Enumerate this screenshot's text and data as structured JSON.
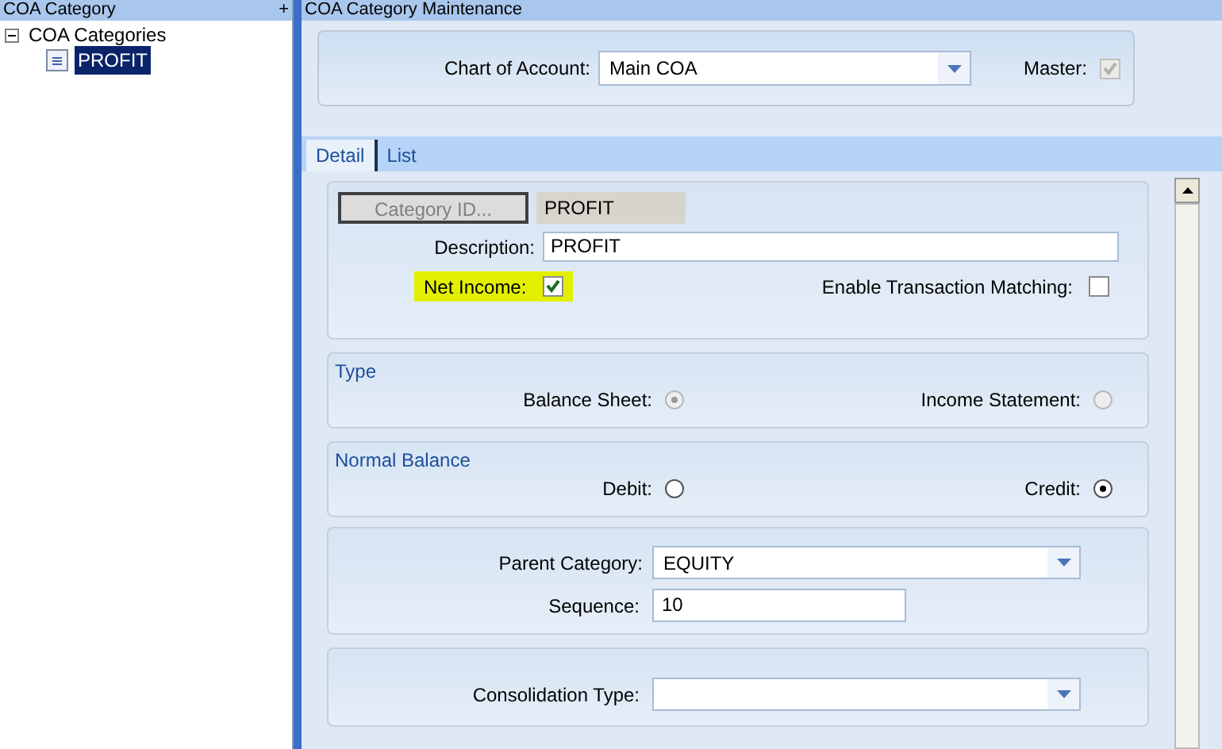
{
  "left_pane": {
    "title": "COA Category",
    "pin": "+",
    "tree": [
      {
        "label": "COA Categories",
        "expanded": true,
        "children": [
          {
            "label": "PROFIT",
            "selected": true
          }
        ]
      }
    ]
  },
  "right_pane": {
    "title": "COA Category Maintenance"
  },
  "header": {
    "chart_label": "Chart of Account:",
    "chart_value": "Main COA",
    "master_label": "Master:",
    "master_checked": true
  },
  "tabs": [
    {
      "label": "Detail",
      "selected": true
    },
    {
      "label": "List",
      "selected": false
    }
  ],
  "detail": {
    "category_button": "Category ID...",
    "category_id": "PROFIT",
    "description_label": "Description:",
    "description": "PROFIT",
    "net_income_label": "Net Income:",
    "net_income": true,
    "matching_label": "Enable Transaction Matching:",
    "matching": false
  },
  "type": {
    "title": "Type",
    "options": [
      {
        "label": "Balance Sheet:",
        "selected": true,
        "disabled": true
      },
      {
        "label": "Income Statement:",
        "selected": false,
        "disabled": true
      }
    ]
  },
  "normal_balance": {
    "title": "Normal Balance",
    "options": [
      {
        "label": "Debit:",
        "selected": false,
        "disabled": false
      },
      {
        "label": "Credit:",
        "selected": true,
        "disabled": false
      }
    ]
  },
  "parent": {
    "parent_label": "Parent Category:",
    "parent_value": "EQUITY",
    "sequence_label": "Sequence:",
    "sequence_value": "10"
  },
  "consolidation": {
    "label": "Consolidation Type:"
  }
}
